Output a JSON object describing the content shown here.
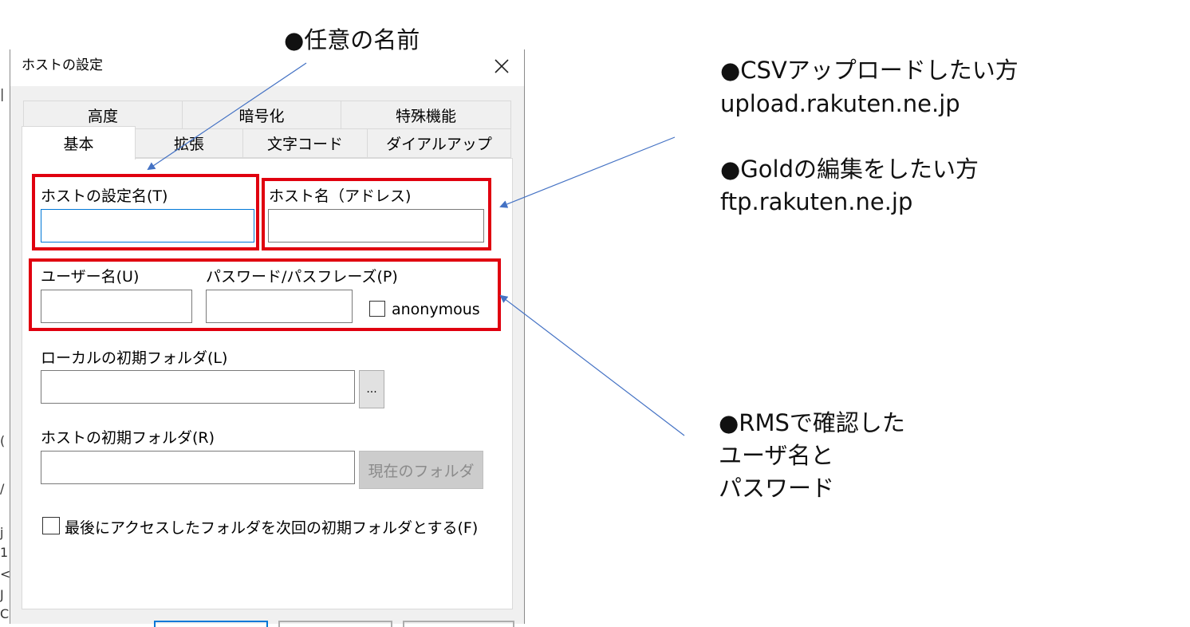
{
  "dialog": {
    "title": "ホストの設定",
    "tabs_row1": [
      "高度",
      "暗号化",
      "特殊機能"
    ],
    "tabs_row2": [
      "基本",
      "拡張",
      "文字コード",
      "ダイアルアップ"
    ],
    "active_tab": "基本",
    "fields": {
      "host_setting_name_label": "ホストの設定名(T)",
      "host_name_label": "ホスト名（アドレス)",
      "user_name_label": "ユーザー名(U)",
      "password_label": "パスワード/パスフレーズ(P)",
      "anonymous_label": "anonymous",
      "local_folder_label": "ローカルの初期フォルダ(L)",
      "browse_button": "...",
      "host_folder_label": "ホストの初期フォルダ(R)",
      "current_folder_button": "現在のフォルダ",
      "last_folder_checkbox_label": "最後にアクセスしたフォルダを次回の初期フォルダとする(F)"
    }
  },
  "annotations": {
    "name_note": "●任意の名前",
    "csv_title": "●CSVアップロードしたい方",
    "csv_host": "upload.rakuten.ne.jp",
    "gold_title": "●Goldの編集をしたい方",
    "gold_host": "ftp.rakuten.ne.jp",
    "rms_line1": "●RMSで確認した",
    "rms_line2": "ユーザ名と",
    "rms_line3": "パスワード"
  },
  "colors": {
    "highlight_red": "#e0000f",
    "arrow_blue": "#4472c4",
    "focus_blue": "#0078d7"
  }
}
